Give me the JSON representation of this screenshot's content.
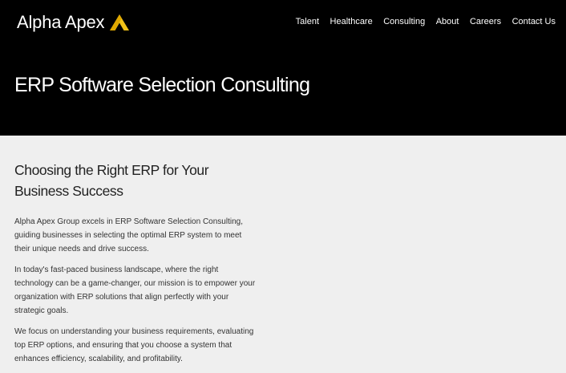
{
  "header": {
    "logo_text": "Alpha Apex",
    "logo_icon": "triangle-a-logo-icon",
    "accent_color": "#f2c318",
    "nav": [
      {
        "label": "Talent"
      },
      {
        "label": "Healthcare"
      },
      {
        "label": "Consulting"
      },
      {
        "label": "About"
      },
      {
        "label": "Careers"
      },
      {
        "label": "Contact Us"
      }
    ]
  },
  "hero": {
    "title": "ERP Software Selection Consulting"
  },
  "main": {
    "heading": "Choosing the Right ERP for Your Business Success",
    "paragraphs": [
      "Alpha Apex Group excels in ERP Software Selection Consulting, guiding businesses in selecting the optimal ERP system to meet their unique needs and drive success.",
      "In today's fast-paced business landscape, where the right technology can be a game-changer, our mission is to empower your organization with ERP solutions that align perfectly with your strategic goals.",
      "We focus on understanding your business requirements, evaluating top ERP options, and ensuring that you choose a system that enhances efficiency, scalability, and profitability."
    ]
  }
}
